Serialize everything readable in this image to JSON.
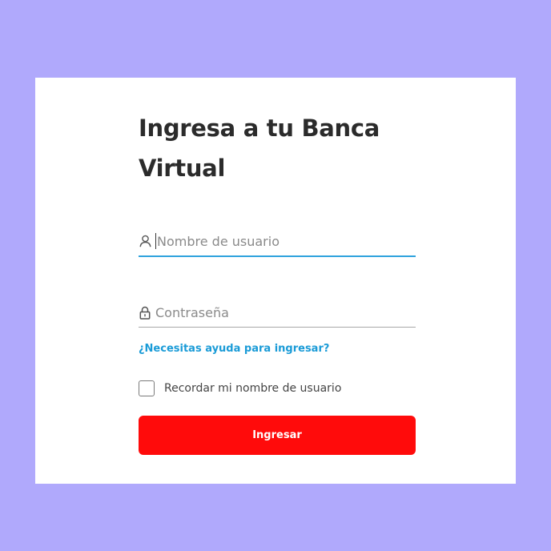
{
  "login": {
    "title": "Ingresa a tu Banca Virtual",
    "username_placeholder": "Nombre de usuario",
    "username_value": "",
    "password_placeholder": "Contraseña",
    "password_value": "",
    "help_link": "¿Necesitas ayuda para ingresar?",
    "remember_label": "Recordar mi nombre de usuario",
    "remember_checked": false,
    "submit_label": "Ingresar"
  },
  "icons": {
    "username": "user-icon",
    "password": "lock-icon"
  },
  "colors": {
    "background": "#b0a9fc",
    "card": "#ffffff",
    "title": "#2b2b2b",
    "active_underline": "#2fa3dd",
    "link": "#1a9bd7",
    "button": "#ff0b0b"
  }
}
